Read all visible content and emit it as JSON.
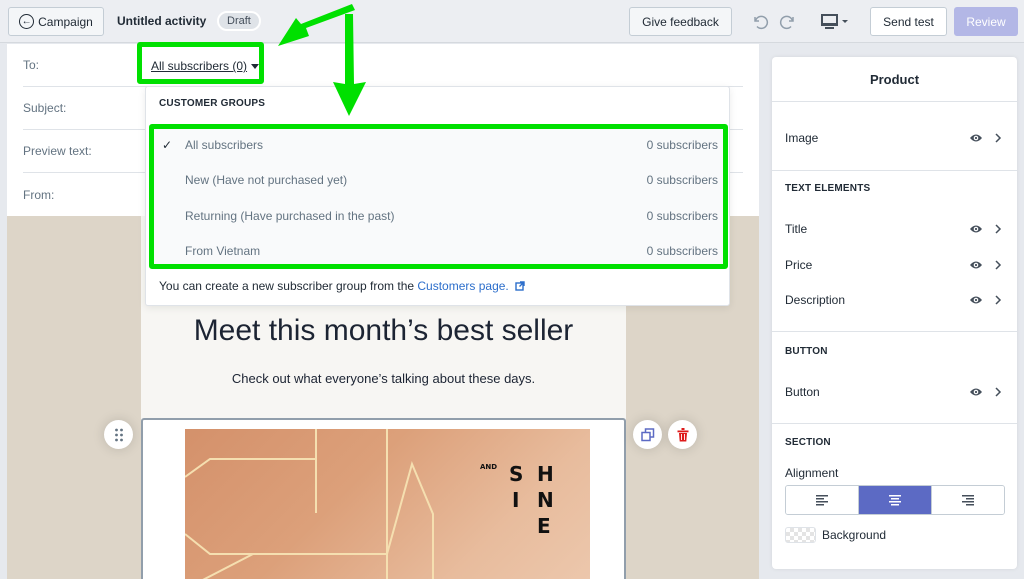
{
  "topbar": {
    "back_label": "Campaign",
    "activity_title": "Untitled activity",
    "status_badge": "Draft",
    "feedback_label": "Give feedback",
    "send_test_label": "Send test",
    "review_label": "Review"
  },
  "form": {
    "to_label": "To:",
    "to_value": "All subscribers (0)",
    "subject_label": "Subject:",
    "preview_label": "Preview text:",
    "from_label": "From:"
  },
  "dropdown": {
    "header": "CUSTOMER GROUPS",
    "items": [
      {
        "label": "All subscribers",
        "count": "0 subscribers",
        "selected": true
      },
      {
        "label": "New (Have not purchased yet)",
        "count": "0 subscribers",
        "selected": false
      },
      {
        "label": "Returning (Have purchased in the past)",
        "count": "0 subscribers",
        "selected": false
      },
      {
        "label": "From Vietnam",
        "count": "0 subscribers",
        "selected": false
      }
    ],
    "footer_text": "You can create a new subscriber group from the ",
    "footer_link": "Customers page."
  },
  "email": {
    "headline": "Meet this month’s best seller",
    "subline": "Check out what everyone’s talking about these days.",
    "image_text": {
      "small": "AND",
      "letters": [
        "S",
        "H",
        "I",
        "N",
        "E"
      ]
    }
  },
  "panel": {
    "title": "Product",
    "image_label": "Image",
    "text_elements_header": "TEXT ELEMENTS",
    "text_elements": [
      "Title",
      "Price",
      "Description"
    ],
    "button_header": "BUTTON",
    "button_label": "Button",
    "section_header": "SECTION",
    "alignment_label": "Alignment",
    "alignment_selected": "center",
    "background_label": "Background"
  },
  "colors": {
    "accent": "#5c6ac4",
    "review_disabled": "#b3b7e6",
    "highlight": "#00e000",
    "link": "#2c6ecb",
    "delete": "#de1a1a",
    "canvas_bg": "#ddd5c8"
  }
}
